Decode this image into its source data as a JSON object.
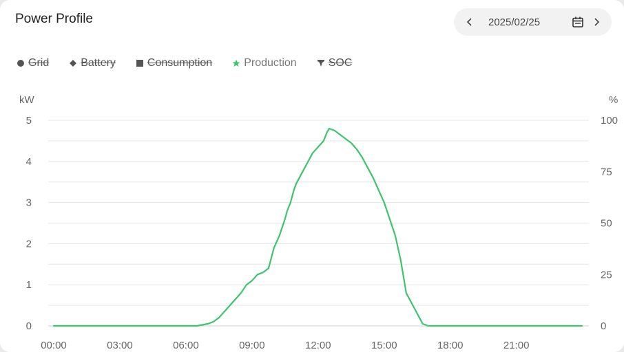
{
  "header": {
    "title": "Power Profile"
  },
  "date_picker": {
    "date": "2025/02/25"
  },
  "legend": [
    {
      "label": "Grid",
      "symbol": "circle",
      "active": false,
      "color": "#555555"
    },
    {
      "label": "Battery",
      "symbol": "diamond",
      "active": false,
      "color": "#555555"
    },
    {
      "label": "Consumption",
      "symbol": "square",
      "active": false,
      "color": "#555555"
    },
    {
      "label": "Production",
      "symbol": "star",
      "active": true,
      "color": "#3ec46d"
    },
    {
      "label": "SOC",
      "symbol": "pin",
      "active": false,
      "color": "#555555"
    }
  ],
  "chart_data": {
    "type": "line",
    "left_unit": "kW",
    "right_unit": "%",
    "ylim": [
      0,
      5
    ],
    "ylim_right": [
      0,
      100
    ],
    "yticks": [
      0,
      1,
      2,
      3,
      4,
      5
    ],
    "yticks_right": [
      0,
      25,
      50,
      75,
      100
    ],
    "xlim": [
      0,
      24
    ],
    "xticks": [
      "00:00",
      "03:00",
      "06:00",
      "09:00",
      "12:00",
      "15:00",
      "18:00",
      "21:00"
    ],
    "grid": true,
    "series": [
      {
        "name": "Production",
        "color": "#3ec46d",
        "x": [
          0,
          6.5,
          7.0,
          7.25,
          7.5,
          7.75,
          8.0,
          8.25,
          8.5,
          8.75,
          9.0,
          9.25,
          9.5,
          9.75,
          10.0,
          10.25,
          10.5,
          10.6,
          10.75,
          10.9,
          11.0,
          11.25,
          11.5,
          11.75,
          12.0,
          12.25,
          12.4,
          12.5,
          12.75,
          13.0,
          13.25,
          13.5,
          13.75,
          14.0,
          14.25,
          14.5,
          14.75,
          15.0,
          15.25,
          15.5,
          15.75,
          16.0,
          16.25,
          16.5,
          16.75,
          17.0,
          17.25,
          17.5,
          17.75,
          18.0,
          24
        ],
        "values": [
          0,
          0,
          0.05,
          0.1,
          0.2,
          0.35,
          0.5,
          0.65,
          0.8,
          1.0,
          1.1,
          1.25,
          1.3,
          1.4,
          1.9,
          2.2,
          2.6,
          2.8,
          3.0,
          3.3,
          3.45,
          3.7,
          3.95,
          4.2,
          4.35,
          4.5,
          4.7,
          4.8,
          4.75,
          4.65,
          4.55,
          4.45,
          4.3,
          4.1,
          3.85,
          3.6,
          3.3,
          3.0,
          2.6,
          2.2,
          1.6,
          0.8,
          0.55,
          0.3,
          0.05,
          0.0,
          0,
          0,
          0,
          0,
          0
        ]
      }
    ]
  }
}
